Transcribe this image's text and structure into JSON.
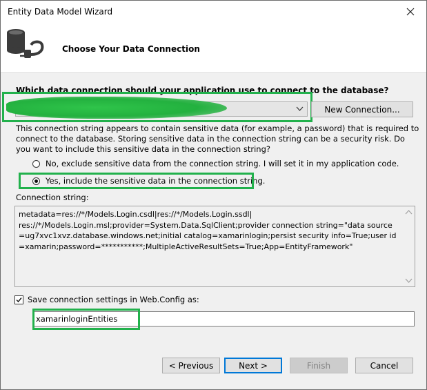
{
  "window": {
    "title": "Entity Data Model Wizard"
  },
  "header": {
    "title": "Choose Your Data Connection"
  },
  "connection": {
    "question": "Which data connection should your application use to connect to the database?",
    "selected_value": "",
    "new_connection_label": "New Connection...",
    "sensitive_note": "This connection string appears to contain sensitive data (for example, a password) that is required to connect to the database. Storing sensitive data in the connection string can be a security risk. Do you want to include this sensitive data in the connection string?",
    "option_exclude": "No, exclude sensitive data from the connection string. I will set it in my application code.",
    "option_include": "Yes, include the sensitive data in the connection string.",
    "selected_option": "include",
    "string_label": "Connection string:",
    "string_value": "metadata=res://*/Models.Login.csdl|res://*/Models.Login.ssdl|\nres://*/Models.Login.msl;provider=System.Data.SqlClient;provider connection string=\"data source=ug7xvc1xvz.database.windows.net;initial catalog=xamarinlogin;persist security info=True;user id=xamarin;password=***********;MultipleActiveResultSets=True;App=EntityFramework\""
  },
  "save": {
    "checkbox_label": "Save connection settings in Web.Config as:",
    "checked": true,
    "entity_name": "xamarinloginEntities"
  },
  "footer": {
    "previous": "< Previous",
    "next": "Next >",
    "finish": "Finish",
    "cancel": "Cancel"
  },
  "colors": {
    "highlight": "#22b14c",
    "accent": "#0078d7"
  }
}
